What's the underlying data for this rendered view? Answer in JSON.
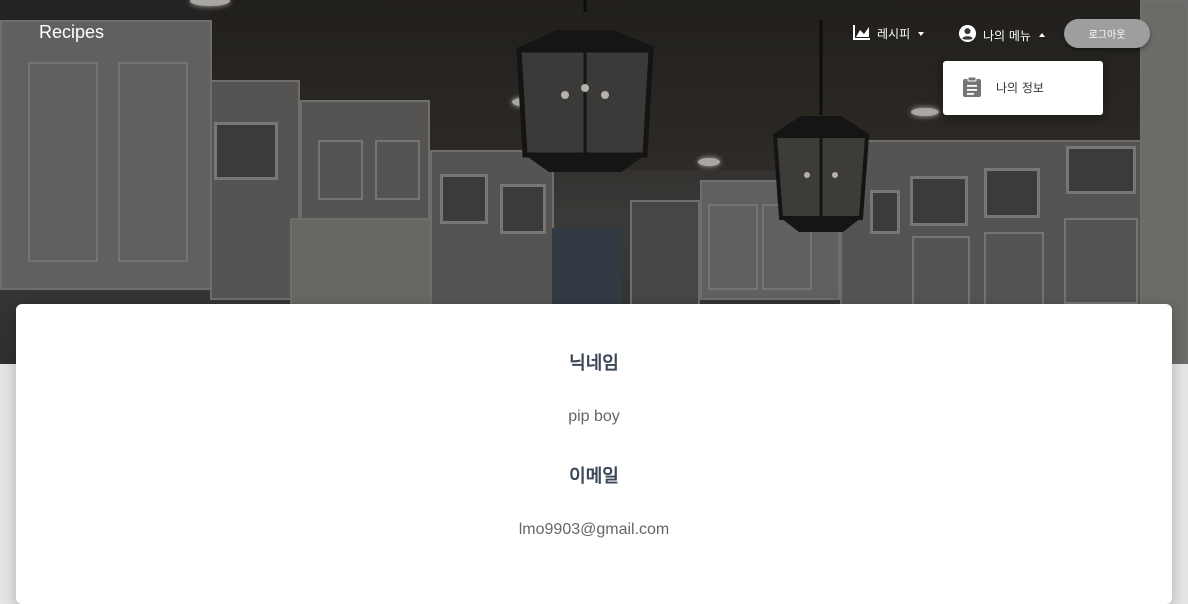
{
  "navbar": {
    "brand": "Recipes",
    "recipe_menu_label": "레시피",
    "my_menu_label": "나의 메뉴",
    "logout_label": "로그아웃"
  },
  "dropdown": {
    "items": [
      {
        "label": "나의 정보",
        "icon": "clipboard-icon"
      }
    ]
  },
  "profile": {
    "nickname_title": "닉네임",
    "nickname_value": "pip boy",
    "email_title": "이메일",
    "email_value": "lmo9903@gmail.com"
  },
  "colors": {
    "logout_button": "#9e9e9e",
    "card_title": "#3c4858",
    "card_value": "#666666"
  }
}
